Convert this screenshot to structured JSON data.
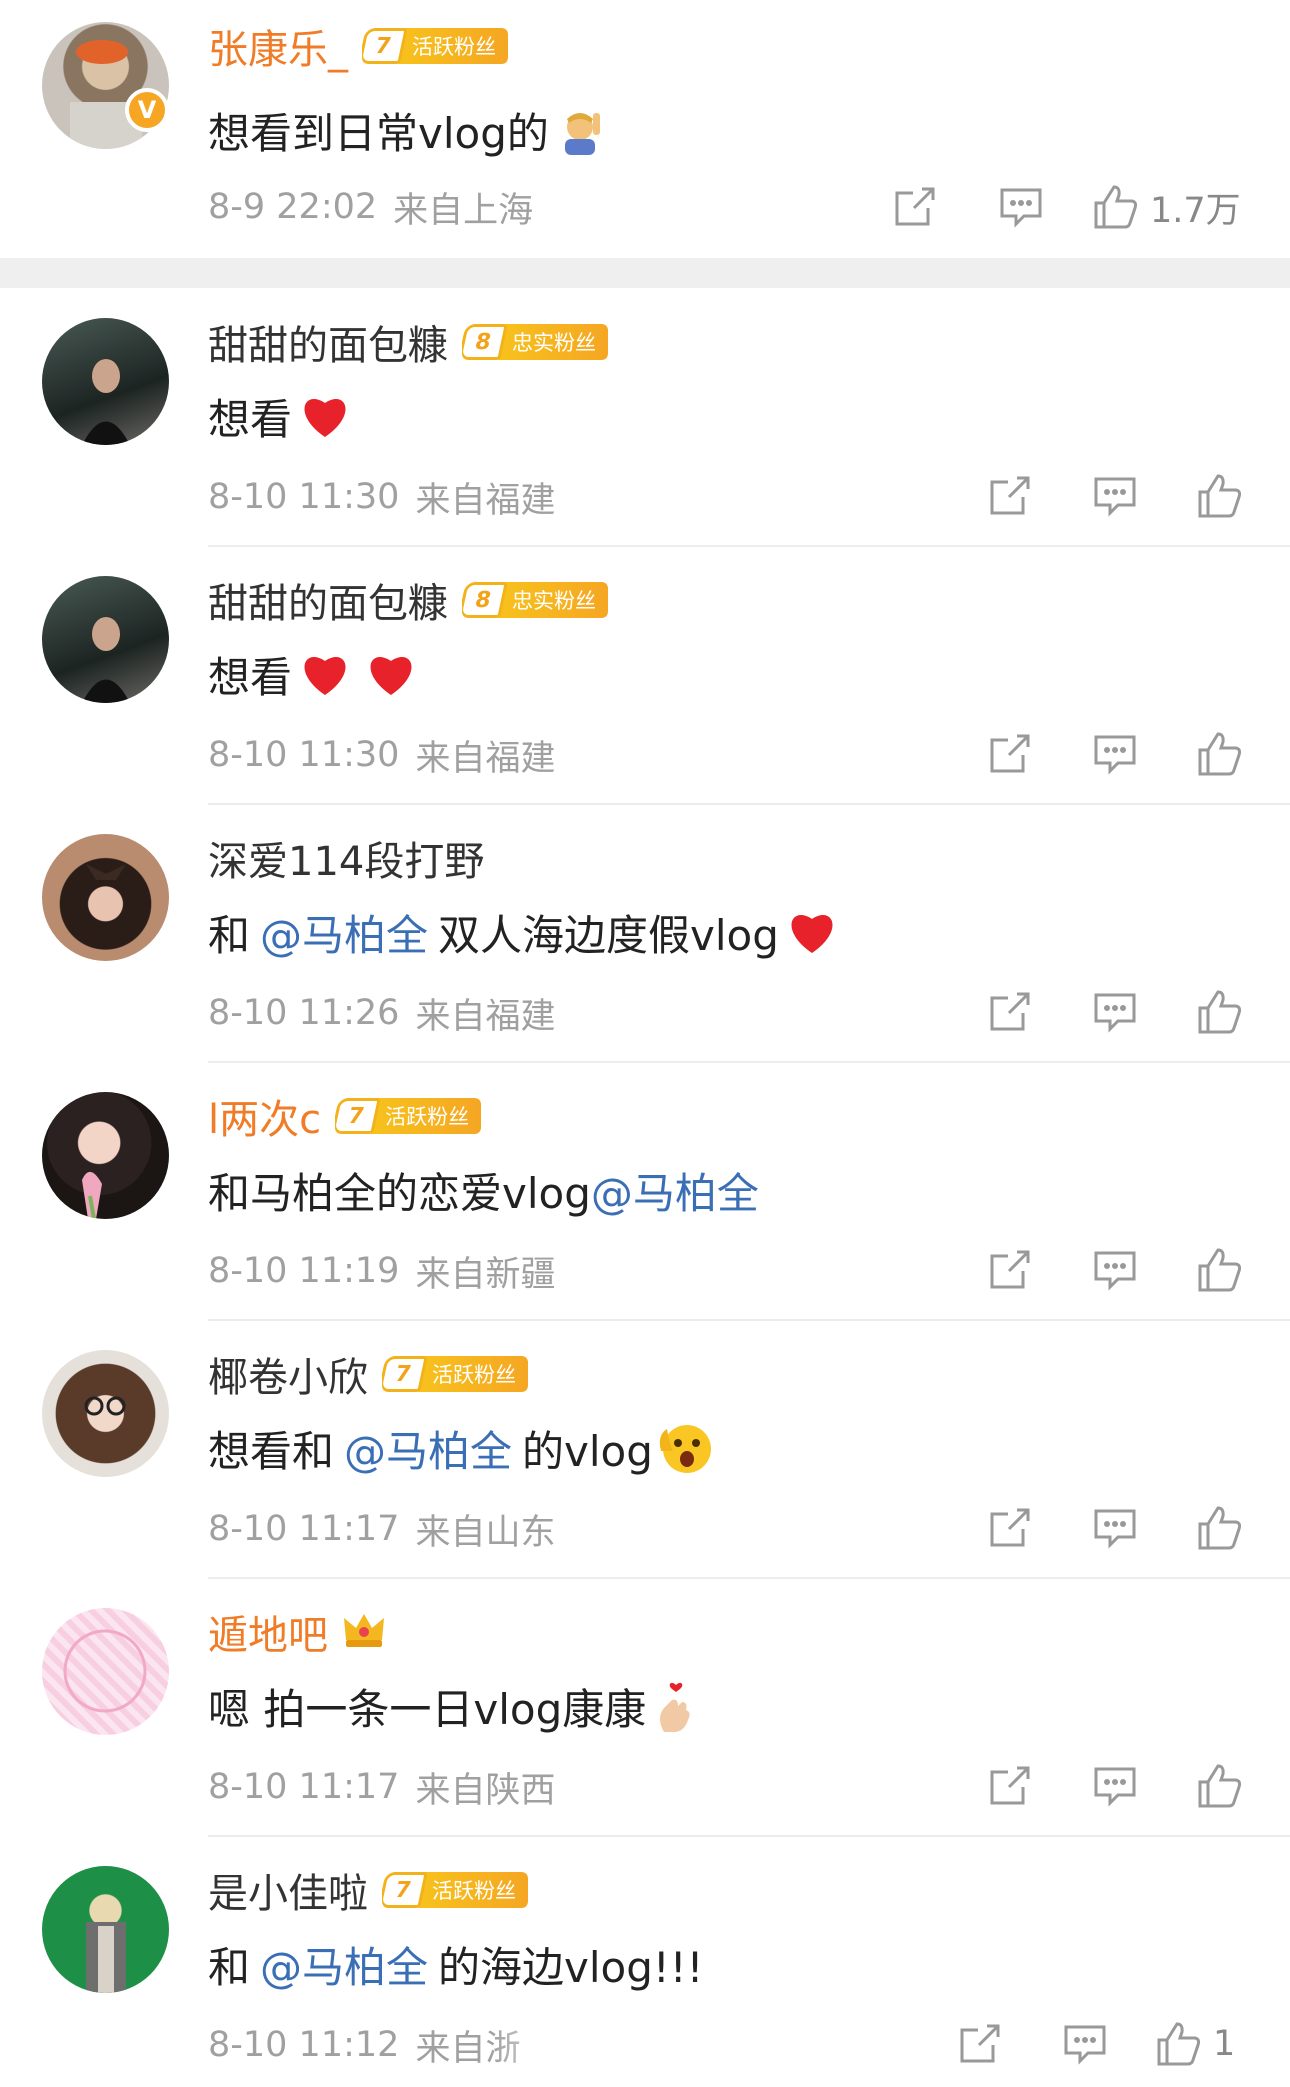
{
  "comments": [
    {
      "user": "张康乐_",
      "badge_level": "7",
      "badge_text": "活跃粉丝",
      "verified": "V",
      "text": "想看到日常vlog的",
      "emoji": "raising-hand-emoji",
      "time": "8-9 22:02",
      "location": "来自上海",
      "likes": "1.7万"
    },
    {
      "user": "甜甜的面包糠",
      "badge_level": "8",
      "badge_text": "忠实粉丝",
      "text": "想看",
      "emoji": "red-heart-emoji",
      "time": "8-10 11:30",
      "location": "来自福建"
    },
    {
      "user": "甜甜的面包糠",
      "badge_level": "8",
      "badge_text": "忠实粉丝",
      "text": "想看",
      "emoji": "two-red-hearts-emoji",
      "time": "8-10 11:30",
      "location": "来自福建"
    },
    {
      "user": "深爱114段打野",
      "text_before": "和",
      "mention": "@马柏全",
      "text_after": "双人海边度假vlog",
      "emoji": "red-heart-emoji",
      "time": "8-10 11:26",
      "location": "来自福建"
    },
    {
      "user": "l两次c",
      "badge_level": "7",
      "badge_text": "活跃粉丝",
      "text_before": "和马柏全的恋爱vlog",
      "mention": "@马柏全",
      "time": "8-10 11:19",
      "location": "来自新疆"
    },
    {
      "user": "椰卷小欣",
      "badge_level": "7",
      "badge_text": "活跃粉丝",
      "text_before": "想看和",
      "mention": "@马柏全",
      "text_after": "的vlog",
      "emoji": "surprised-face-emoji",
      "time": "8-10 11:17",
      "location": "来自山东"
    },
    {
      "user": "遁地吧",
      "crown": "crown-icon",
      "text": "嗯 拍一条一日vlog康康",
      "emoji": "finger-heart-emoji",
      "time": "8-10 11:17",
      "location": "来自陕西"
    },
    {
      "user": "是小佳啦",
      "badge_level": "7",
      "badge_text": "活跃粉丝",
      "text_before": "和",
      "mention": "@马柏全",
      "text_after": "的海边vlog!!!",
      "time": "8-10 11:12",
      "location": "来自浙",
      "likes": "1"
    }
  ],
  "icons": {
    "share": "share-icon",
    "reply": "comment-icon",
    "like": "thumbs-up-icon"
  },
  "colors": {
    "vip_name": "#f07c27",
    "mention": "#3a6fb5",
    "badge": "#f5a623",
    "meta": "#a0a0a0"
  }
}
